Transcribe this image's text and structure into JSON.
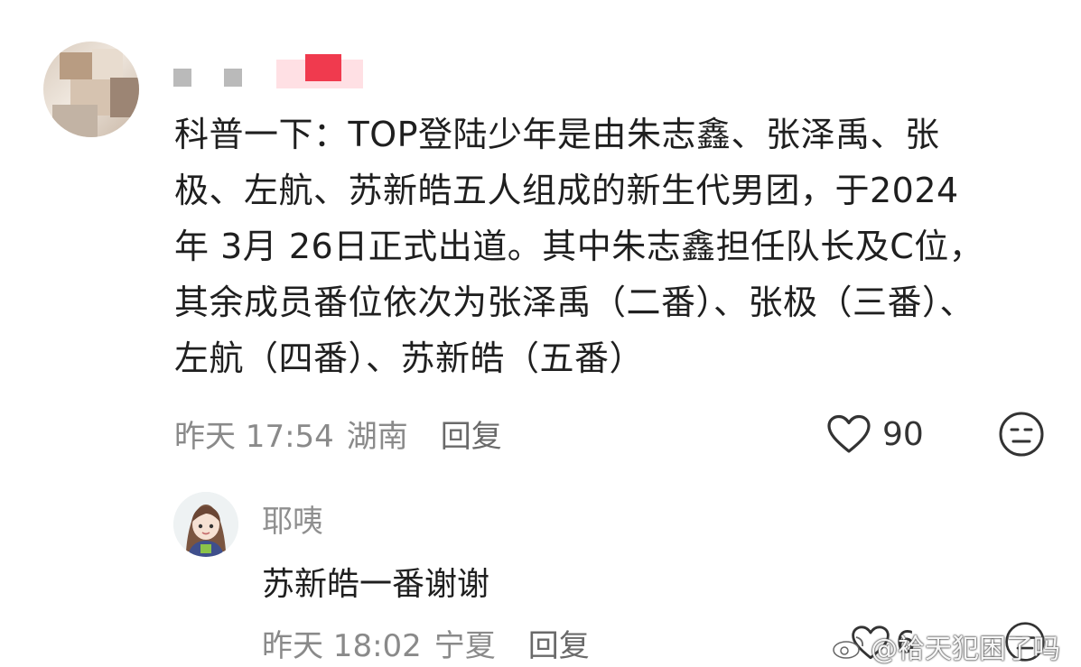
{
  "comment": {
    "username": "",
    "lines": [
      "科普一下：TOP登陆少年是由朱志鑫、张泽禹、张",
      "极、左航、苏新皓五人组成的新生代男团，于2024",
      "年 3月 26日正式出道。其中朱志鑫担任队长及C位，",
      "其余成员番位依次为张泽禹（二番）、张极（三番）、",
      "左航（四番）、苏新皓（五番）"
    ],
    "time": "昨天 17:54",
    "location": "湖南",
    "reply_label": "回复",
    "like_count": "90",
    "like_icon": "heart-outline-icon",
    "emoji_icon": "neutral-face-icon"
  },
  "reply": {
    "username": "耶咦",
    "text": "苏新皓一番谢谢",
    "time": "昨天 18:02",
    "location": "宁夏",
    "reply_label": "回复",
    "like_count": "6"
  },
  "watermark": {
    "text": "@袷天犯困了吗",
    "icon": "weibo-logo-icon"
  }
}
